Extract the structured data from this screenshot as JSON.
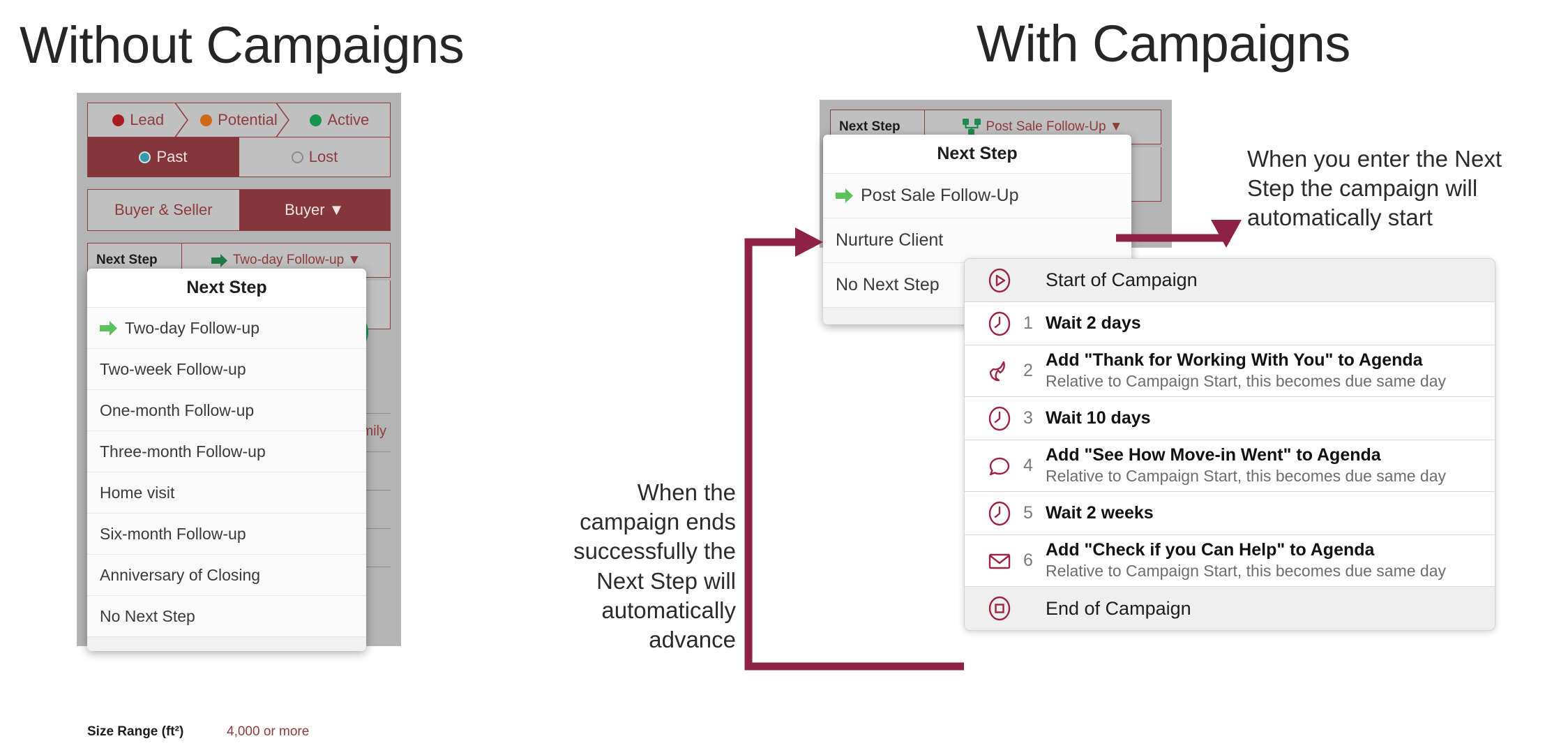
{
  "headings": {
    "without": "Without Campaigns",
    "with": "With Campaigns"
  },
  "colors": {
    "maroon": "#83373a",
    "maroon_line": "#8e3b3f",
    "crimson": "#9c2346",
    "panel_grey": "#b4b4b4",
    "green_arrow": "#5cc25c",
    "green_icon": "#1f8a4c",
    "lead_dot": "#a81d23",
    "potential_dot": "#cc6a17",
    "active_dot": "#17924f",
    "past_dot": "#3799a8"
  },
  "left_panel": {
    "pipeline": [
      {
        "label": "Lead",
        "dot": "#a81d23"
      },
      {
        "label": "Potential",
        "dot": "#cc6a17"
      },
      {
        "label": "Active",
        "dot": "#17924f"
      }
    ],
    "status_row": [
      {
        "label": "Past",
        "selected": true
      },
      {
        "label": "Lost",
        "selected": false
      }
    ],
    "role_row": [
      {
        "label": "Buyer & Seller",
        "selected": false
      },
      {
        "label": "Buyer ▼",
        "selected": true
      }
    ],
    "next_step_row": {
      "key": "Next Step",
      "value": "Two-day Follow-up ▼",
      "icon": "green-arrow-icon"
    },
    "size_row": {
      "key": "Size Range (ft²)",
      "value": "4,000 or more"
    },
    "dropdown": {
      "title": "Next Step",
      "items": [
        {
          "label": "Two-day Follow-up",
          "icon": "green-arrow-icon"
        },
        {
          "label": "Two-week Follow-up",
          "icon": ""
        },
        {
          "label": "One-month Follow-up",
          "icon": ""
        },
        {
          "label": "Three-month Follow-up",
          "icon": ""
        },
        {
          "label": "Home visit",
          "icon": ""
        },
        {
          "label": "Six-month Follow-up",
          "icon": ""
        },
        {
          "label": "Anniversary of Closing",
          "icon": ""
        },
        {
          "label": "No Next Step",
          "icon": ""
        }
      ]
    }
  },
  "right_panel": {
    "next_step_row": {
      "key": "Next Step",
      "value": "Post Sale Follow-Up ▼",
      "icon": "campaign-sitemap-icon"
    },
    "dropdown": {
      "title": "Next Step",
      "items": [
        {
          "label": "Post Sale Follow-Up",
          "icon": "green-arrow-icon"
        },
        {
          "label": "Nurture Client",
          "icon": ""
        },
        {
          "label": "No Next Step",
          "icon": ""
        }
      ]
    }
  },
  "campaign": {
    "steps": [
      {
        "num": "",
        "icon": "play-circle-icon",
        "title": "Start of Campaign",
        "caption": "",
        "endcap": true
      },
      {
        "num": "1",
        "icon": "clock-icon",
        "title": "Wait 2 days",
        "caption": "",
        "endcap": false
      },
      {
        "num": "2",
        "icon": "phone-icon",
        "title": "Add \"Thank for Working With You\" to Agenda",
        "caption": "Relative to Campaign Start, this becomes due same day",
        "endcap": false
      },
      {
        "num": "3",
        "icon": "clock-icon",
        "title": "Wait 10 days",
        "caption": "",
        "endcap": false
      },
      {
        "num": "4",
        "icon": "comment-icon",
        "title": "Add \"See How Move-in Went\" to Agenda",
        "caption": "Relative to Campaign Start, this becomes due same day",
        "endcap": false
      },
      {
        "num": "5",
        "icon": "clock-icon",
        "title": "Wait 2 weeks",
        "caption": "",
        "endcap": false
      },
      {
        "num": "6",
        "icon": "envelope-icon",
        "title": "Add \"Check if you Can Help\" to Agenda",
        "caption": "Relative to Campaign Start, this becomes due same day",
        "endcap": false
      },
      {
        "num": "",
        "icon": "stop-circle-icon",
        "title": "End of Campaign",
        "caption": "",
        "endcap": true
      }
    ]
  },
  "annotations": {
    "top_right": "When you enter the Next Step the campaign will automatically start",
    "bottom_middle": "When the campaign ends successfully the Next Step will automatically advance"
  }
}
